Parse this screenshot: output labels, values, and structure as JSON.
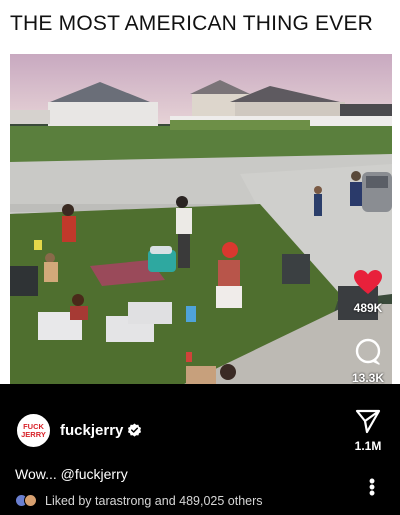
{
  "headline": "THE MOST AMERICAN THING EVER",
  "post": {
    "username": "fuckjerry",
    "avatar_text_top": "FUCK",
    "avatar_text_bottom": "JERRY",
    "caption": "Wow... @fuckjerry",
    "liked_by_text": "Liked by tarastrong and 489,025 others"
  },
  "actions": {
    "like_count": "489K",
    "comment_count": "13.3K",
    "share_count": "1.1M"
  },
  "colors": {
    "like": "#e8213b",
    "overlay_bg": "#000000",
    "brand": "#d8232a"
  },
  "icons": {
    "like": "heart-icon",
    "comment": "comment-icon",
    "share": "paper-plane-icon",
    "more": "more-vertical-icon",
    "verified": "verified-badge-icon"
  }
}
